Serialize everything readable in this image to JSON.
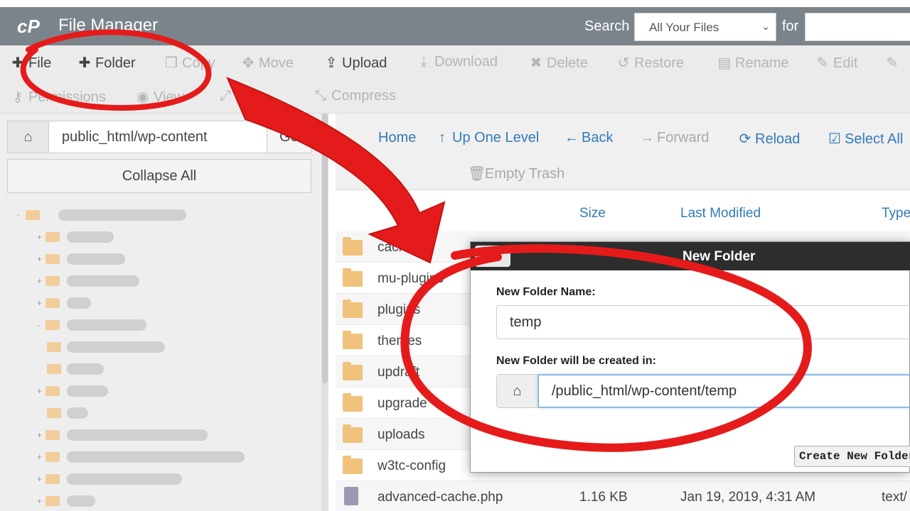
{
  "header": {
    "logo": "cP",
    "title": "File Manager",
    "search_label": "Search",
    "search_scope": "All Your Files",
    "for_label": "for",
    "search_value": ""
  },
  "toolbar": {
    "file": "File",
    "folder": "Folder",
    "copy": "Copy",
    "move": "Move",
    "upload": "Upload",
    "download": "Download",
    "delete": "Delete",
    "restore": "Restore",
    "rename": "Rename",
    "edit": "Edit",
    "permissions": "Permissions",
    "view": "View",
    "compress": "Compress"
  },
  "sidebar": {
    "path": "public_html/wp-content",
    "go": "Go",
    "collapse_all": "Collapse All"
  },
  "nav": {
    "home": "Home",
    "up_one_level": "Up One Level",
    "back": "Back",
    "forward": "Forward",
    "reload": "Reload",
    "select_all": "Select All",
    "empty_trash": "Empty Trash"
  },
  "columns": {
    "size": "Size",
    "last_modified": "Last Modified",
    "type": "Type"
  },
  "files": [
    {
      "name": "cache",
      "size": "",
      "modified": "",
      "type": "",
      "kind": "folder"
    },
    {
      "name": "mu-plugins",
      "size": "",
      "modified": "",
      "type": "",
      "kind": "folder"
    },
    {
      "name": "plugins",
      "size": "",
      "modified": "",
      "type": "",
      "kind": "folder"
    },
    {
      "name": "themes",
      "size": "",
      "modified": "",
      "type": "",
      "kind": "folder"
    },
    {
      "name": "updraft",
      "size": "",
      "modified": "",
      "type": "",
      "kind": "folder"
    },
    {
      "name": "upgrade",
      "size": "",
      "modified": "",
      "type": "",
      "kind": "folder"
    },
    {
      "name": "uploads",
      "size": "",
      "modified": "",
      "type": "",
      "kind": "folder"
    },
    {
      "name": "w3tc-config",
      "size": "",
      "modified": "",
      "type": "",
      "kind": "folder"
    },
    {
      "name": "advanced-cache.php",
      "size": "1.16 KB",
      "modified": "Jan 19, 2019, 4:31 AM",
      "type": "text/",
      "kind": "file"
    }
  ],
  "dialog": {
    "title": "New Folder",
    "close": "✕",
    "name_label": "New Folder Name:",
    "name_value": "temp",
    "location_label": "New Folder will be created in:",
    "location_value": "/public_html/wp-content/temp",
    "create_button": "Create New Folder"
  },
  "colors": {
    "header_bg": "#7b848b",
    "link_blue": "#337ab7",
    "annotation_red": "#e51b1b",
    "folder_yellow": "#f0c27b"
  }
}
